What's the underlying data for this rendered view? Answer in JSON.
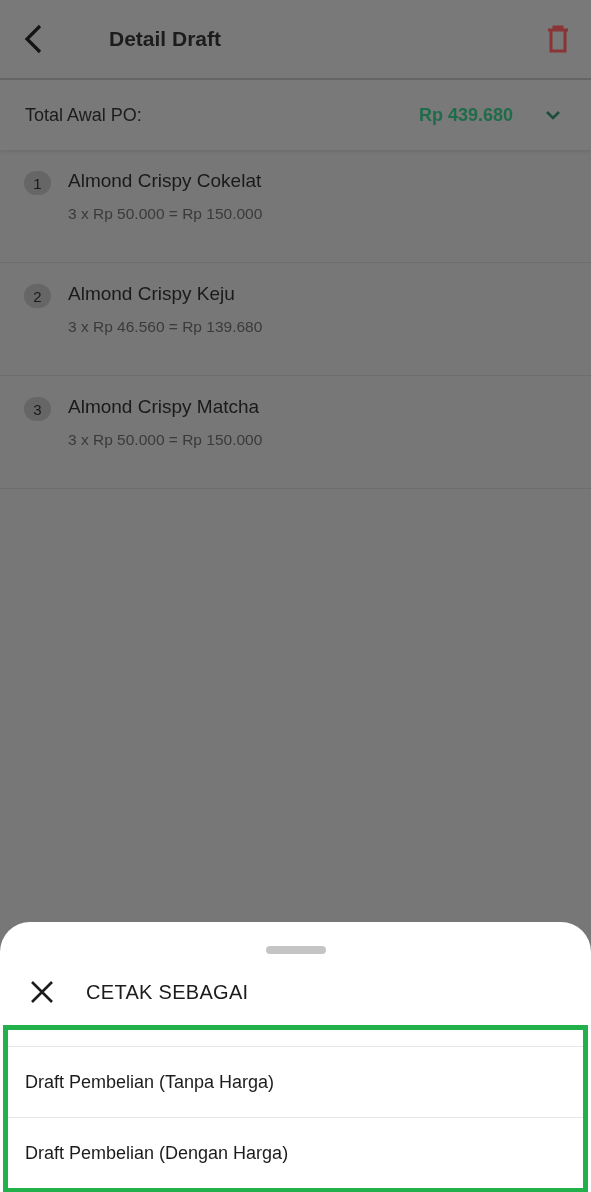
{
  "header": {
    "title": "Detail Draft"
  },
  "total": {
    "label": "Total Awal PO:",
    "value": "Rp 439.680"
  },
  "items": [
    {
      "number": "1",
      "name": "Almond Crispy Cokelat",
      "detail": "3 x Rp 50.000 = Rp 150.000"
    },
    {
      "number": "2",
      "name": "Almond Crispy Keju",
      "detail": "3 x Rp 46.560 = Rp 139.680"
    },
    {
      "number": "3",
      "name": "Almond Crispy Matcha",
      "detail": "3 x Rp 50.000 = Rp 150.000"
    }
  ],
  "sheet": {
    "title": "CETAK SEBAGAI",
    "options": [
      "Draft Pembelian (Tanpa Harga)",
      "Draft Pembelian (Dengan Harga)"
    ]
  }
}
